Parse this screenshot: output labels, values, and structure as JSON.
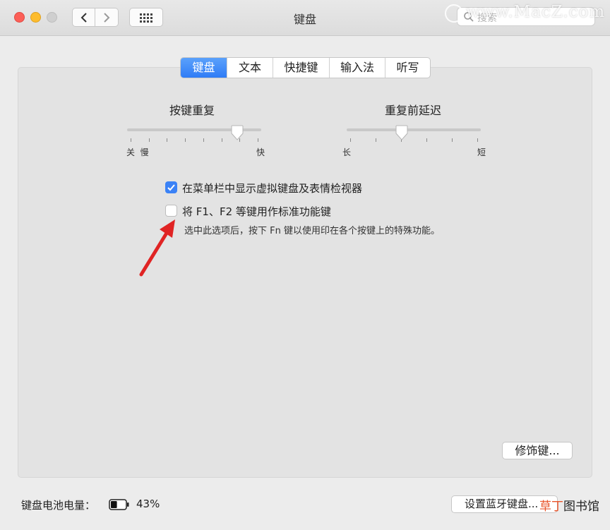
{
  "window": {
    "title": "键盘"
  },
  "toolbar": {
    "back_icon": "chevron-left-icon",
    "forward_icon": "chevron-right-icon",
    "grid_icon": "grid-icon",
    "search_placeholder": "搜索"
  },
  "watermark": {
    "site": "www.MacZ.com"
  },
  "tabs": [
    {
      "label": "键盘",
      "active": true
    },
    {
      "label": "文本",
      "active": false
    },
    {
      "label": "快捷键",
      "active": false
    },
    {
      "label": "输入法",
      "active": false
    },
    {
      "label": "听写",
      "active": false
    }
  ],
  "key_repeat": {
    "title": "按键重复",
    "left_labels": "关  慢",
    "right_label": "快",
    "value_fraction": 0.82
  },
  "repeat_delay": {
    "title": "重复前延迟",
    "left_label": "长",
    "right_label": "短",
    "value_fraction": 0.41
  },
  "options": {
    "show_viewer": {
      "label": "在菜单栏中显示虚拟键盘及表情检视器",
      "checked": true
    },
    "fn_keys": {
      "label": "将 F1、F2 等键用作标准功能键",
      "checked": false,
      "description": "选中此选项后，按下 Fn 键以使用印在各个按键上的特殊功能。"
    }
  },
  "buttons": {
    "modifier": "修饰键...",
    "bluetooth": "设置蓝牙键盘..."
  },
  "battery": {
    "label": "键盘电池电量：",
    "percent": "43%",
    "level": 0.43
  },
  "footer_watermark": {
    "orange": "草丁",
    "black": "图书馆"
  },
  "colors": {
    "accent": "#3b82f6",
    "arrow": "#e02424"
  }
}
